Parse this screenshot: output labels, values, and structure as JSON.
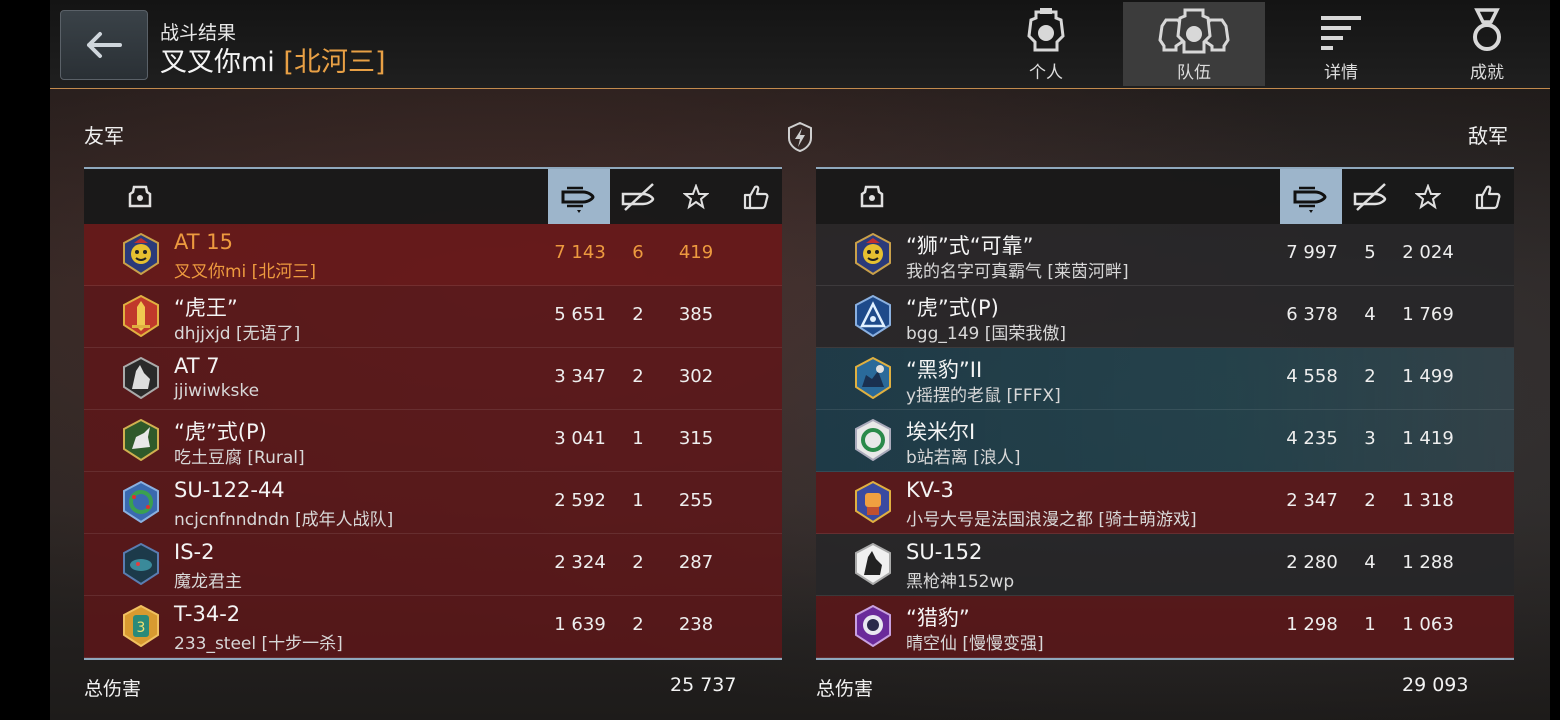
{
  "header": {
    "subtitle": "战斗结果",
    "player_name": "叉叉你mi",
    "player_clan": "[北河三]",
    "tabs": [
      {
        "label": "个人",
        "icon": "personal-helmet-icon"
      },
      {
        "label": "队伍",
        "icon": "team-helmets-icon"
      },
      {
        "label": "详情",
        "icon": "details-list-icon"
      },
      {
        "label": "成就",
        "icon": "achievement-medal-icon"
      }
    ],
    "active_tab": "队伍"
  },
  "allies": {
    "title": "友军",
    "total_label": "总伤害",
    "total_damage": "25 737",
    "rows": [
      {
        "tank": "AT 15",
        "player": "叉叉你mi [北河三]",
        "damage": "7 143",
        "kills": "6",
        "xp": "419",
        "me": true,
        "emblem": "red-face"
      },
      {
        "tank": "“虎王”",
        "player": "dhjjxjd [无语了]",
        "damage": "5 651",
        "kills": "2",
        "xp": "385",
        "emblem": "gold-sword"
      },
      {
        "tank": "AT 7",
        "player": "jjiwiwkske",
        "damage": "3 347",
        "kills": "2",
        "xp": "302",
        "emblem": "wolf"
      },
      {
        "tank": "“虎”式(P)",
        "player": "吃土豆腐 [Rural]",
        "damage": "3 041",
        "kills": "1",
        "xp": "315",
        "emblem": "green-unicorn"
      },
      {
        "tank": "SU-122-44",
        "player": "ncjcnfnndndn [成年人战队]",
        "damage": "2 592",
        "kills": "1",
        "xp": "255",
        "emblem": "wreath"
      },
      {
        "tank": "IS-2",
        "player": "魔龙君主",
        "damage": "2 324",
        "kills": "2",
        "xp": "287",
        "emblem": "dragon"
      },
      {
        "tank": "T-34-2",
        "player": "233_steel [十步一杀]",
        "damage": "1 639",
        "kills": "2",
        "xp": "238",
        "emblem": "number-three"
      }
    ]
  },
  "enemies": {
    "title": "敌军",
    "total_label": "总伤害",
    "total_damage": "29 093",
    "rows": [
      {
        "tank": "“狮”式“可靠”",
        "player": "我的名字可真霸气 [莱茵河畔]",
        "damage": "7 997",
        "kills": "5",
        "xp": "2 024",
        "emblem": "red-face"
      },
      {
        "tank": "“虎”式(P)",
        "player": "bgg_149 [国荣我傲]",
        "damage": "6 378",
        "kills": "4",
        "xp": "1 769",
        "emblem": "blue-triangle"
      },
      {
        "tank": "“黑豹”II",
        "player": "y摇摆的老鼠 [FFFX]",
        "damage": "4 558",
        "kills": "2",
        "xp": "1 499",
        "emblem": "blue-castle"
      },
      {
        "tank": "埃米尔I",
        "player": "b站若离 [浪人]",
        "damage": "4 235",
        "kills": "3",
        "xp": "1 419",
        "emblem": "wreath-grey"
      },
      {
        "tank": "KV-3",
        "player": "小号大号是法国浪漫之都 [骑士萌游戏]",
        "damage": "2 347",
        "kills": "2",
        "xp": "1 318",
        "emblem": "fist"
      },
      {
        "tank": "SU-152",
        "player": "黑枪神152wp",
        "damage": "2 280",
        "kills": "4",
        "xp": "1 288",
        "emblem": "wolf"
      },
      {
        "tank": "“猎豹”",
        "player": "晴空仙 [慢慢变强]",
        "damage": "1 298",
        "kills": "1",
        "xp": "1 063",
        "emblem": "astronaut"
      }
    ]
  },
  "colors": {
    "accent": "#e8a045",
    "row_red": "#5f1618",
    "header_line": "#8fa8bd",
    "sorted_column": "#9db5cb"
  }
}
